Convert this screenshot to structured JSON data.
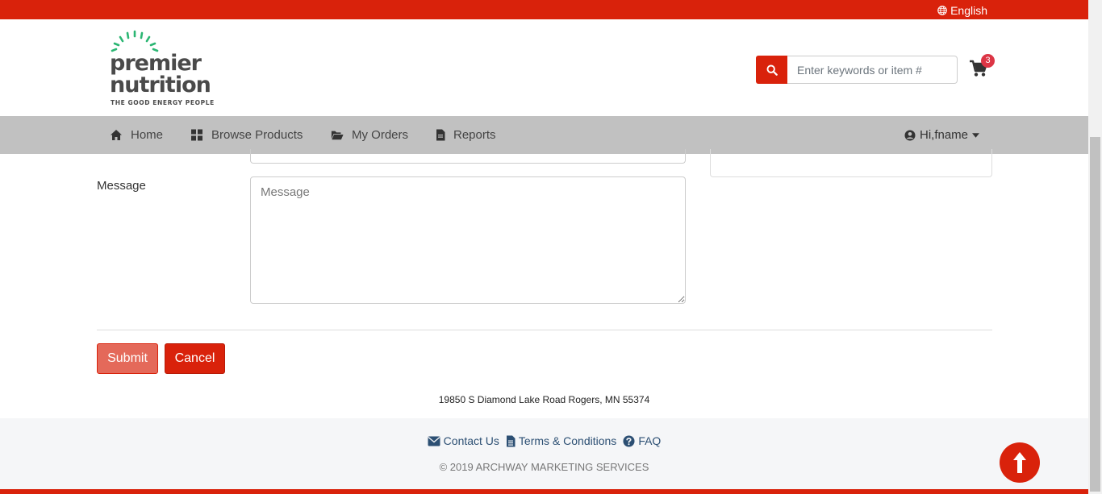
{
  "topbar": {
    "language": "English",
    "language_icon": "globe-icon"
  },
  "brand": {
    "name_line1": "premier",
    "name_line2": "nutrition",
    "tagline": "THE GOOD ENERGY PEOPLE",
    "ray_color": "#2bb673",
    "text_color": "#4a4a4a"
  },
  "search": {
    "placeholder": "Enter keywords or item #",
    "icon": "search-icon"
  },
  "cart": {
    "count": "3",
    "icon": "shopping-cart-icon"
  },
  "nav": {
    "items": [
      {
        "label": "Home",
        "icon": "home-icon"
      },
      {
        "label": "Browse Products",
        "icon": "grid-icon"
      },
      {
        "label": "My Orders",
        "icon": "folder-open-icon"
      },
      {
        "label": "Reports",
        "icon": "file-icon"
      }
    ],
    "user_label": "Hi,fname"
  },
  "form": {
    "message_label": "Message",
    "message_placeholder": "Message",
    "submit_label": "Submit",
    "cancel_label": "Cancel"
  },
  "address": "19850 S Diamond Lake Road Rogers, MN 55374",
  "footer": {
    "links": [
      {
        "label": "Contact Us",
        "icon": "envelope-icon"
      },
      {
        "label": "Terms & Conditions",
        "icon": "document-icon"
      },
      {
        "label": "FAQ",
        "icon": "question-circle-icon"
      }
    ],
    "copyright": "© 2019 ARCHWAY MARKETING SERVICES"
  },
  "colors": {
    "accent": "#d9220b",
    "nav_bg": "#c1c1c1",
    "footer_bg": "#f5f6f8",
    "link": "#2c4f73",
    "badge": "#dc3545"
  }
}
